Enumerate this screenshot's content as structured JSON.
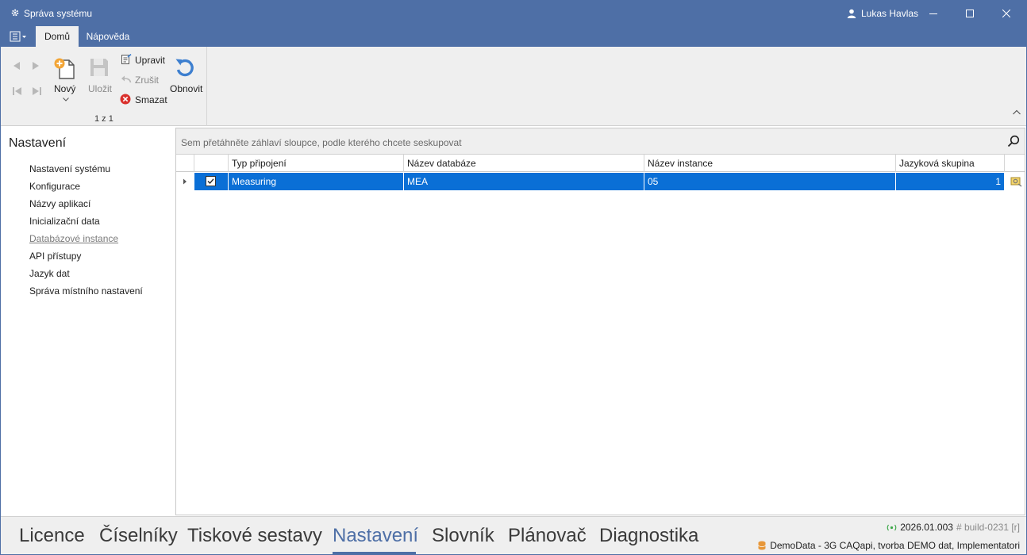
{
  "window": {
    "title": "Správa systému",
    "user": "Lukas Havlas"
  },
  "ribbon_tabs": [
    {
      "label": "Domů"
    },
    {
      "label": "Nápověda"
    }
  ],
  "ribbon": {
    "new_label": "Nový",
    "save_label": "Uložit",
    "edit_label": "Upravit",
    "cancel_label": "Zrušit",
    "delete_label": "Smazat",
    "refresh_label": "Obnovit",
    "record_position": "1 z 1"
  },
  "sidebar": {
    "title": "Nastavení",
    "items": [
      {
        "label": "Nastavení systému"
      },
      {
        "label": "Konfigurace"
      },
      {
        "label": "Názvy aplikací"
      },
      {
        "label": "Inicializační data"
      },
      {
        "label": "Databázové instance"
      },
      {
        "label": "API přístupy"
      },
      {
        "label": "Jazyk dat"
      },
      {
        "label": "Správa místního nastavení"
      }
    ]
  },
  "grid": {
    "group_hint": "Sem přetáhněte záhlaví sloupce, podle kterého chcete seskupovat",
    "columns": [
      "Typ připojení",
      "Název databáze",
      "Název instance",
      "Jazyková skupina"
    ],
    "rows": [
      {
        "typ": "Measuring",
        "databaze": "MEA",
        "instance": "05",
        "skupina": "1"
      }
    ]
  },
  "bottom_tabs": [
    {
      "label": "Licence"
    },
    {
      "label": "Číselníky"
    },
    {
      "label": "Tiskové sestavy"
    },
    {
      "label": "Nastavení"
    },
    {
      "label": "Slovník"
    },
    {
      "label": "Plánovač"
    },
    {
      "label": "Diagnostika"
    }
  ],
  "status": {
    "version": "2026.01.003",
    "build": "# build-0231 [r]",
    "database": "DemoData - 3G CAQapi, tvorba DEMO dat, Implementatori"
  },
  "colors": {
    "accent": "#4e6fa6",
    "selection": "#0a6fd6",
    "delete_red": "#d9302c",
    "new_orange": "#f3a536",
    "refresh_blue": "#3d7fcf"
  }
}
